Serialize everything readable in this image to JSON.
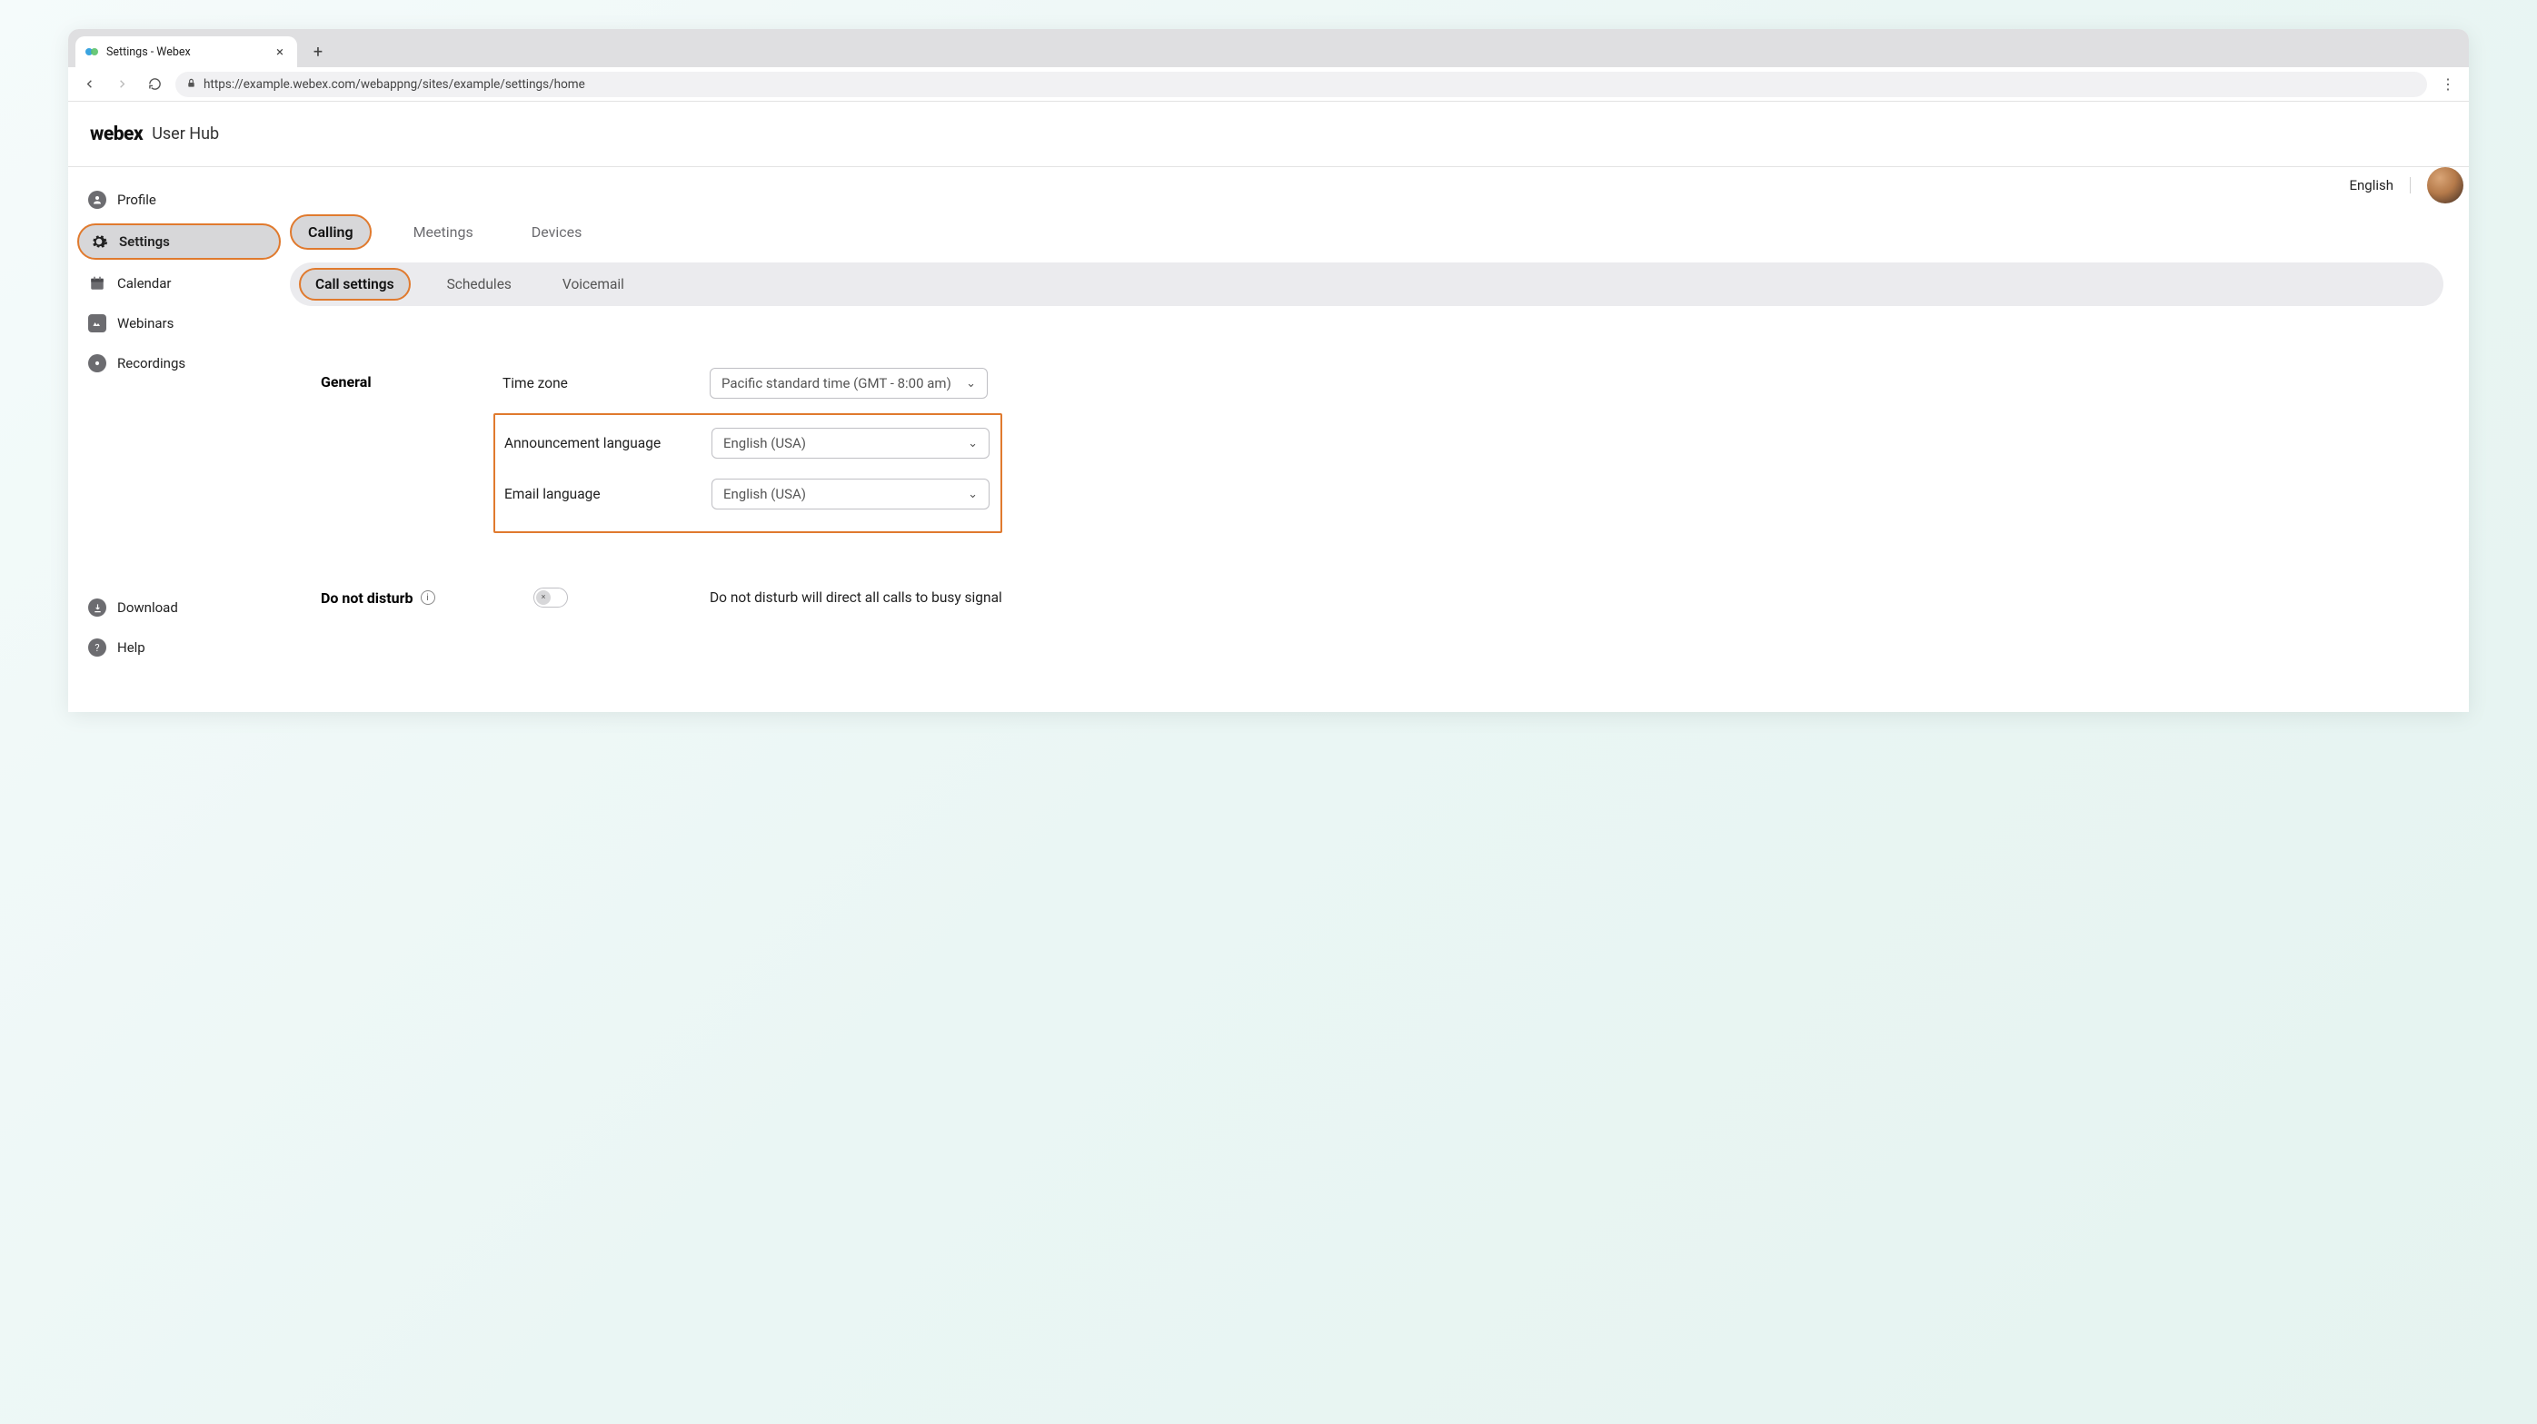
{
  "browser": {
    "tab_title": "Settings - Webex",
    "url": "https://example.webex.com/webappng/sites/example/settings/home"
  },
  "header": {
    "brand": "webex",
    "product": "User Hub",
    "language": "English"
  },
  "sidebar": {
    "items": [
      {
        "label": "Profile",
        "icon": "user"
      },
      {
        "label": "Settings",
        "icon": "gear",
        "active": true
      },
      {
        "label": "Calendar",
        "icon": "calendar"
      },
      {
        "label": "Webinars",
        "icon": "webinar"
      },
      {
        "label": "Recordings",
        "icon": "record"
      }
    ],
    "footer": [
      {
        "label": "Download",
        "icon": "download"
      },
      {
        "label": "Help",
        "icon": "help"
      }
    ]
  },
  "tabs": {
    "main": [
      "Calling",
      "Meetings",
      "Devices"
    ],
    "sub": [
      "Call settings",
      "Schedules",
      "Voicemail"
    ]
  },
  "general": {
    "heading": "General",
    "timezone": {
      "label": "Time zone",
      "value": "Pacific standard time (GMT - 8:00 am)"
    },
    "announcement": {
      "label": "Announcement language",
      "value": "English (USA)"
    },
    "email": {
      "label": "Email language",
      "value": "English (USA)"
    }
  },
  "dnd": {
    "heading": "Do not disturb",
    "description": "Do not disturb will direct all calls to busy signal",
    "enabled": false
  }
}
